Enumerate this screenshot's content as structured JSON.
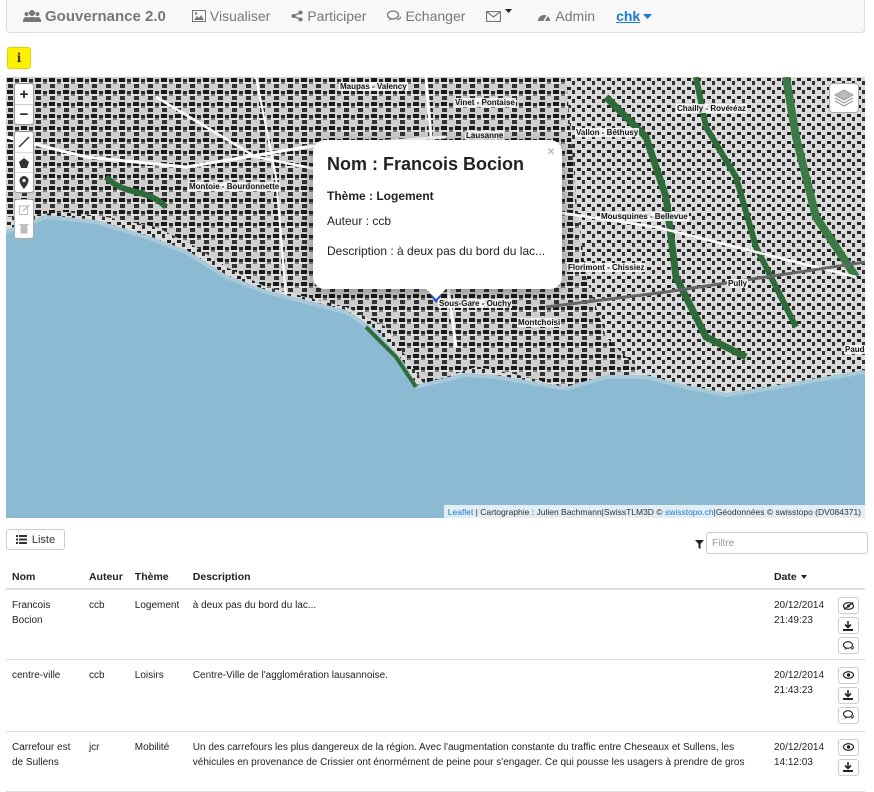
{
  "navbar": {
    "brand": "Gouvernance 2.0",
    "items": [
      {
        "label": "Visualiser",
        "icon": "picture-icon"
      },
      {
        "label": "Participer",
        "icon": "share-icon"
      },
      {
        "label": "Echanger",
        "icon": "comments-icon"
      },
      {
        "label": "",
        "icon": "envelope-icon"
      },
      {
        "label": "Admin",
        "icon": "dashboard-icon"
      }
    ],
    "user": "chk"
  },
  "info_button": "i",
  "map": {
    "popup": {
      "title": "Nom : Francois Bocion",
      "theme": "Thème : Logement",
      "author": "Auteur : ccb",
      "description": "Description : à deux pas du bord du lac...",
      "close": "×"
    },
    "zoom_in": "+",
    "zoom_out": "−",
    "labels": [
      "Maupas - Valency",
      "Vinet - Pontaise",
      "Lausanne",
      "Vallon - Béthusy",
      "Chailly - Rovéréaz",
      "Montoie - Bourdonnette",
      "Mousquines - Bellevue",
      "Florimont - Chissiez",
      "Pully",
      "Sous-Gare - Ouchy",
      "Montchoisi",
      "Paudex"
    ],
    "attribution": {
      "leaflet": "Leaflet",
      "text1": " | Cartographie : Julien Bachmann|SwissTLM3D © ",
      "swisstopo": "swisstopo.ch",
      "text2": "|Géodonnées © swisstopo (DV084371)"
    }
  },
  "list_button": "Liste",
  "filter_placeholder": "Filtre",
  "table": {
    "headers": [
      "Nom",
      "Auteur",
      "Thème",
      "Description",
      "Date"
    ],
    "rows": [
      {
        "nom": "Francois Bocion",
        "auteur": "ccb",
        "theme": "Logement",
        "description": "à deux pas du bord du lac...",
        "date": "20/12/2014",
        "time": "21:49:23"
      },
      {
        "nom": "centre-ville",
        "auteur": "ccb",
        "theme": "Loisirs",
        "description": "Centre-Ville de l'agglomération lausannoise.",
        "date": "20/12/2014",
        "time": "21:43:23"
      },
      {
        "nom": "Carrefour est de Sullens",
        "auteur": "jcr",
        "theme": "Mobilité",
        "description": "Un des carrefours les plus dangereux de la région. Avec l'augmentation constante du traffic entre Cheseaux et Sullens, les véhicules en provenance de Crissier ont énormément de peine pour s'engager. Ce qui pousse les usagers à prendre de gros",
        "date": "20/12/2014",
        "time": "14:12:03"
      }
    ]
  }
}
